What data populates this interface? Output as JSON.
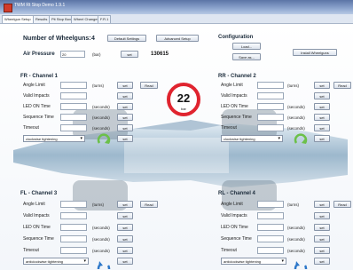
{
  "window": {
    "title": "TWM Rt Stop Demo 1.9.1"
  },
  "tabs": [
    "Wheelgun Setup",
    "Results",
    "Pit Stop Box",
    "Wheel Changes",
    "F.R.1"
  ],
  "main": {
    "wheelguns_label": "Number of Wheelguns:",
    "wheelguns_value": "4",
    "default_btn": "Default Settings",
    "advanced_btn": "Advanced Setup",
    "air_label": "Air Pressure",
    "air_value": "20",
    "air_unit": "(bar)",
    "air_set": "set",
    "air_reading": "130615"
  },
  "config": {
    "title": "Configuration",
    "load": "Load...",
    "save_as": "Save as...",
    "install": "Install Wheelguns"
  },
  "badge": {
    "value": "22",
    "unit": "bar"
  },
  "channels": [
    {
      "title": "FR - Channel 1",
      "angle": "Angle Limit",
      "angle_unit": "(turns)",
      "impacts": "Valid Impacts",
      "led": "LED ON Time",
      "led_unit": "(seconds)",
      "seq": "Sequence Time",
      "seq_unit": "(seconds)",
      "timeout": "Timeout",
      "timeout_unit": "(seconds)",
      "direction": "clockwise tightening",
      "set": "set",
      "read": "Read"
    },
    {
      "title": "RR - Channel 2",
      "angle": "Angle Limit",
      "angle_unit": "(turns)",
      "impacts": "Valid Impacts",
      "led": "LED ON Time",
      "led_unit": "(seconds)",
      "seq": "Sequence Time",
      "seq_unit": "(seconds)",
      "timeout": "Timeout",
      "timeout_unit": "(seconds)",
      "direction": "clockwise tightening",
      "set": "set",
      "read": "Read"
    },
    {
      "title": "FL - Channel 3",
      "angle": "Angle Limit",
      "angle_unit": "(turns)",
      "impacts": "Valid Impacts",
      "led": "LED ON Time",
      "led_unit": "(seconds)",
      "seq": "Sequence Time",
      "seq_unit": "(seconds)",
      "timeout": "Timeout",
      "timeout_unit": "(seconds)",
      "direction": "anticlockwise tightening",
      "set": "set",
      "read": "Read"
    },
    {
      "title": "RL - Channel 4",
      "angle": "Angle Limit",
      "angle_unit": "(turns)",
      "impacts": "Valid Impacts",
      "led": "LED ON Time",
      "led_unit": "(seconds)",
      "seq": "Sequence Time",
      "seq_unit": "(seconds)",
      "timeout": "Timeout",
      "timeout_unit": "(seconds)",
      "direction": "anticlockwise tightening",
      "set": "set",
      "read": "Read"
    }
  ],
  "wheel_labels": [
    "FR",
    "RR",
    "FL",
    "RL"
  ],
  "colors": {
    "accent_green": "#6cc04a",
    "accent_blue": "#2c77c9",
    "badge_red": "#e0242f"
  }
}
